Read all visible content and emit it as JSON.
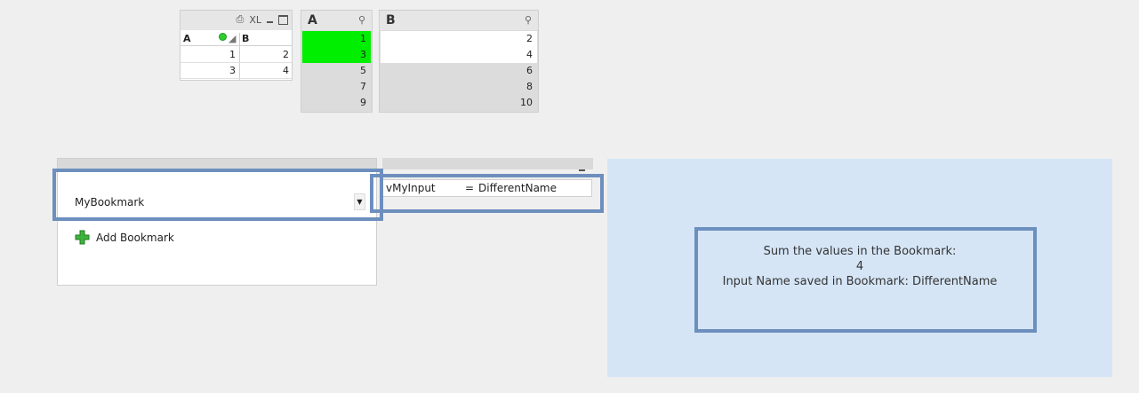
{
  "table_box": {
    "caption_icons": [
      "print-icon",
      "excel-icon",
      "minimize-icon",
      "maximize-icon"
    ],
    "excel_label": "XL",
    "headers": {
      "a": "A",
      "b": "B"
    },
    "rows": [
      {
        "a": "1",
        "b": "2"
      },
      {
        "a": "3",
        "b": "4"
      }
    ]
  },
  "listbox_a": {
    "title": "A",
    "items": [
      {
        "value": "1",
        "state": "selected"
      },
      {
        "value": "3",
        "state": "selected"
      },
      {
        "value": "5",
        "state": "excluded"
      },
      {
        "value": "7",
        "state": "excluded"
      },
      {
        "value": "9",
        "state": "excluded"
      }
    ]
  },
  "listbox_b": {
    "title": "B",
    "items": [
      {
        "value": "2",
        "state": "possible"
      },
      {
        "value": "4",
        "state": "possible"
      },
      {
        "value": "6",
        "state": "excluded"
      },
      {
        "value": "8",
        "state": "excluded"
      },
      {
        "value": "10",
        "state": "excluded"
      }
    ]
  },
  "bookmark": {
    "selected": "MyBookmark",
    "add_label": "Add Bookmark"
  },
  "input_box": {
    "variable": "vMyInput",
    "equals": "=",
    "value": "DifferentName"
  },
  "text_object": {
    "line1": "Sum the values in the Bookmark:",
    "line2": "4",
    "line3": "Input Name saved in Bookmark: DifferentName"
  },
  "colors": {
    "selected": "#00ee00",
    "highlight_frame": "#6d8fbd",
    "text_bg": "#d5e5f6"
  }
}
